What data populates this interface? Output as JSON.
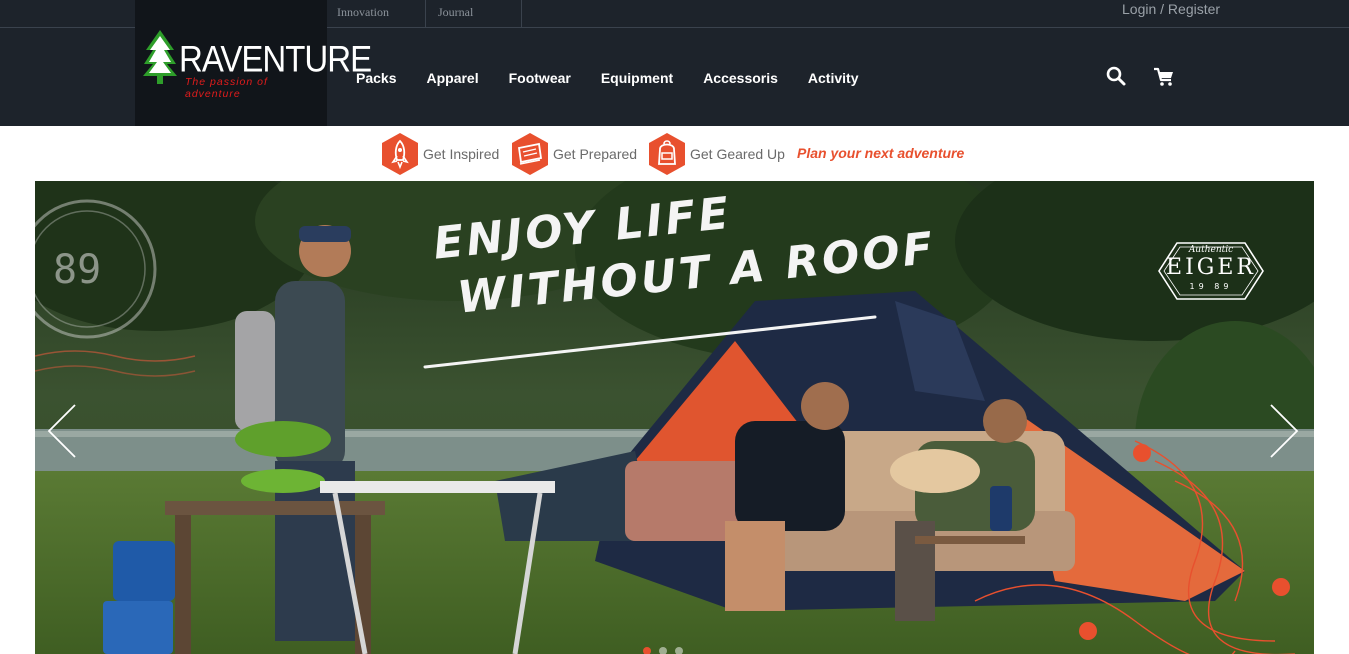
{
  "brand": {
    "name": "RAVENTURE",
    "tagline": "The passion of adventure"
  },
  "topbar": {
    "links": [
      {
        "label": "Innovation"
      },
      {
        "label": "Journal"
      }
    ],
    "login_label": "Login / Register"
  },
  "nav": {
    "items": [
      {
        "label": "Packs"
      },
      {
        "label": "Apparel"
      },
      {
        "label": "Footwear"
      },
      {
        "label": "Equipment"
      },
      {
        "label": "Accessoris"
      },
      {
        "label": "Activity"
      }
    ],
    "icons": [
      "search-icon",
      "cart-icon"
    ]
  },
  "subnav": {
    "items": [
      {
        "label": "Get Inspired",
        "icon": "rocket-icon"
      },
      {
        "label": "Get Prepared",
        "icon": "map-icon"
      },
      {
        "label": "Get Geared Up",
        "icon": "backpack-icon"
      }
    ],
    "plan_label": "Plan your next adventure"
  },
  "hero": {
    "headline_line1": "ENJOY LIFE",
    "headline_line2": "WITHOUT A ROOF",
    "badge": {
      "top": "Authentic",
      "brand": "EIGER",
      "year": "19 89"
    },
    "stamp_number": "89",
    "slides": 3,
    "active_slide": 1
  },
  "colors": {
    "header_bg": "#1d232b",
    "logo_bg": "#11151a",
    "accent": "#e8502e",
    "logo_red": "#e01c1c",
    "tree_green": "#2e9e2a"
  }
}
